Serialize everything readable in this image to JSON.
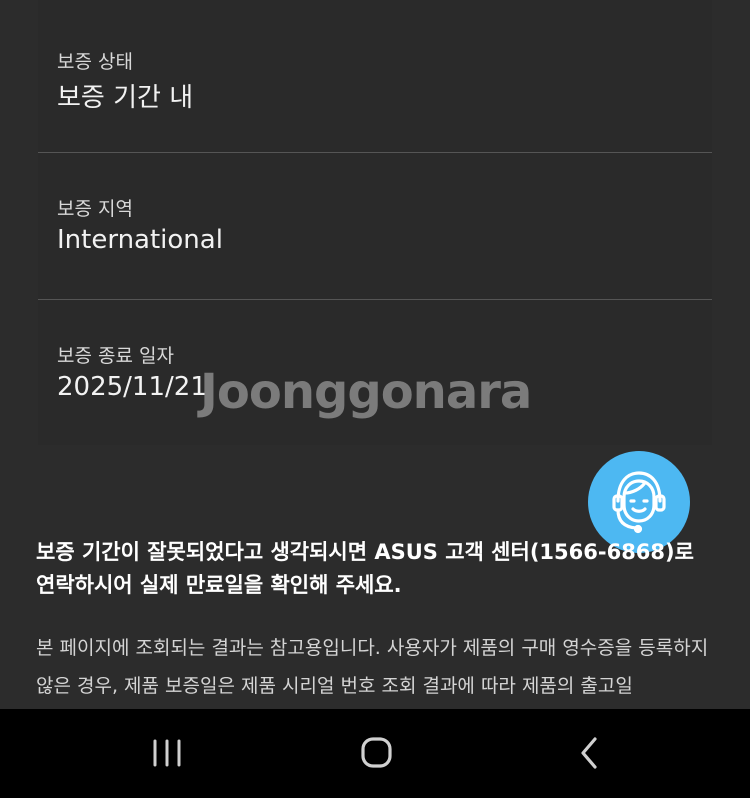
{
  "warranty": {
    "status": {
      "label": "보증 상태",
      "value": "보증 기간 내"
    },
    "region": {
      "label": "보증 지역",
      "value": "International"
    },
    "end_date": {
      "label": "보증 종료 일자",
      "value": "2025/11/21"
    }
  },
  "watermark": "Joonggonara",
  "notice": "보증 기간이 잘못되었다고 생각되시면 ASUS 고객 센터(1566-6868)로 연락하시어 실제 만료일을 확인해 주세요.",
  "description": "본 페이지에 조회되는 결과는 참고용입니다. 사용자가 제품의 구매 영수증을 등록하지 않은 경우, 제품 보증일은 제품 시리얼 번호 조회 결과에 따라 제품의 출고일",
  "support_button": {
    "icon": "headset-agent-icon",
    "color": "#4db8f2"
  },
  "navbar": {
    "recent_icon": "recent-apps-icon",
    "home_icon": "home-icon",
    "back_icon": "back-icon"
  }
}
